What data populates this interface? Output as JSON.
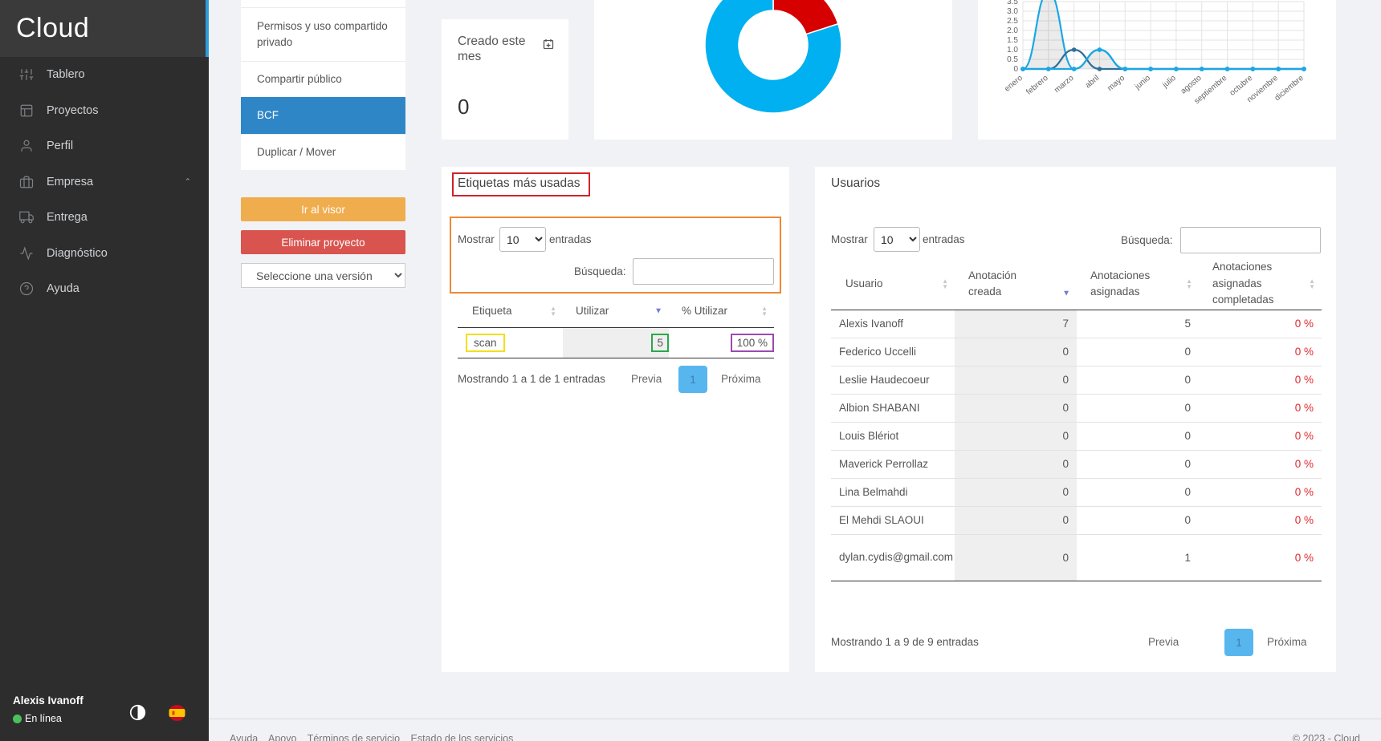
{
  "sidebar": {
    "brand": "Cloud",
    "items": [
      {
        "label": "Tablero",
        "icon": "sliders-icon"
      },
      {
        "label": "Proyectos",
        "icon": "layout-icon"
      },
      {
        "label": "Perfil",
        "icon": "user-icon"
      },
      {
        "label": "Empresa",
        "icon": "briefcase-icon"
      },
      {
        "label": "Entrega",
        "icon": "truck-icon"
      },
      {
        "label": "Diagnóstico",
        "icon": "activity-icon"
      },
      {
        "label": "Ayuda",
        "icon": "help-circle-icon"
      }
    ],
    "user_name": "Alexis Ivanoff",
    "status": "En línea"
  },
  "project_menu": {
    "items": [
      "Permisos y uso compartido privado",
      "Compartir público",
      "BCF",
      "Duplicar / Mover"
    ],
    "active": "BCF",
    "viewer_button": "Ir al visor",
    "delete_button": "Eliminar proyecto",
    "version_placeholder": "Seleccione una versión"
  },
  "stat_card": {
    "title": "Creado este mes",
    "value": "0"
  },
  "colors": {
    "donut_blue": "#00b0f0",
    "donut_red": "#d70000",
    "line_blue": "#1aa7e5",
    "line_dark": "#2f6f9a"
  },
  "chart_data": [
    {
      "type": "pie",
      "subtype": "donut",
      "note": "only the lower portion of the donut is visible",
      "values": [
        20,
        80
      ]
    },
    {
      "type": "line",
      "categories": [
        "enero",
        "febrero",
        "marzo",
        "abril",
        "mayo",
        "junio",
        "julio",
        "agosto",
        "septiembre",
        "octubre",
        "noviembre",
        "diciembre"
      ],
      "y_ticks": [
        "0",
        "0.5",
        "1.0",
        "1.5",
        "2.0",
        "2.5",
        "3.0",
        "3.5"
      ],
      "ylim": [
        0,
        3.5
      ],
      "grid": true,
      "series": [
        {
          "values": [
            0,
            4,
            0,
            1,
            0,
            0,
            0,
            0,
            0,
            0,
            0,
            0
          ],
          "fill": true
        },
        {
          "values": [
            0,
            0,
            1,
            0,
            0,
            0,
            0,
            0,
            0,
            0,
            0,
            0
          ]
        },
        {
          "values": [
            0,
            0,
            0,
            1,
            0,
            0,
            0,
            0,
            0,
            0,
            0,
            0
          ]
        }
      ]
    }
  ],
  "tags": {
    "title": "Etiquetas más usadas",
    "show_label": "Mostrar",
    "page_size": "10",
    "entries_label": "entradas",
    "search_label": "Búsqueda:",
    "columns": [
      "Etiqueta",
      "Utilizar",
      "% Utilizar"
    ],
    "rows": [
      {
        "tag": "scan",
        "use": "5",
        "percent": "100 %"
      }
    ],
    "info": "Mostrando 1 a 1 de 1 entradas",
    "prev": "Previa",
    "page": "1",
    "next": "Próxima"
  },
  "users": {
    "title": "Usuarios",
    "show_label": "Mostrar",
    "page_size": "10",
    "entries_label": "entradas",
    "search_label": "Búsqueda:",
    "columns": [
      "Usuario",
      "Anotación creada",
      "Anotaciones asignadas",
      "Anotaciones asignadas completadas"
    ],
    "rows": [
      {
        "name": "Alexis Ivanoff",
        "created": "7",
        "assigned": "5",
        "done": "0 %"
      },
      {
        "name": "Federico Uccelli",
        "created": "0",
        "assigned": "0",
        "done": "0 %"
      },
      {
        "name": "Leslie Haudecoeur",
        "created": "0",
        "assigned": "0",
        "done": "0 %"
      },
      {
        "name": "Albion SHABANI",
        "created": "0",
        "assigned": "0",
        "done": "0 %"
      },
      {
        "name": "Louis Blériot",
        "created": "0",
        "assigned": "0",
        "done": "0 %"
      },
      {
        "name": "Maverick Perrollaz",
        "created": "0",
        "assigned": "0",
        "done": "0 %"
      },
      {
        "name": "Lina Belmahdi",
        "created": "0",
        "assigned": "0",
        "done": "0 %"
      },
      {
        "name": "El Mehdi SLAOUI",
        "created": "0",
        "assigned": "0",
        "done": "0 %"
      },
      {
        "name": "dylan.cydis@gmail.com",
        "created": "0",
        "assigned": "1",
        "done": "0 %"
      }
    ],
    "info": "Mostrando 1 a 9 de 9 entradas",
    "prev": "Previa",
    "page": "1",
    "next": "Próxima"
  },
  "footer": {
    "links": [
      "Ayuda",
      "Apoyo",
      "Términos de servicio",
      "Estado de los servicios"
    ],
    "copyright": "© 2023 - Cloud"
  }
}
